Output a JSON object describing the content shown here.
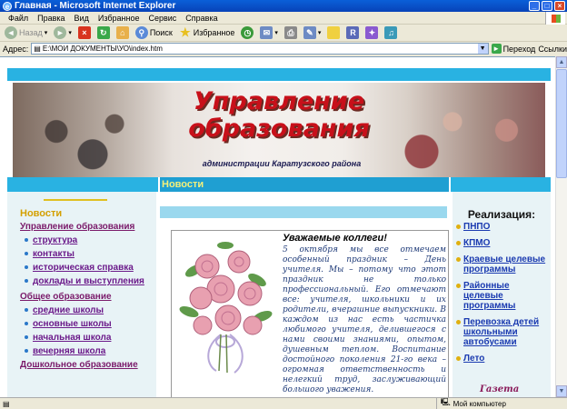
{
  "window": {
    "title": "Главная - Microsoft Internet Explorer"
  },
  "menu": [
    "Файл",
    "Правка",
    "Вид",
    "Избранное",
    "Сервис",
    "Справка"
  ],
  "toolbar": {
    "back": "Назад",
    "search": "Поиск",
    "favorites": "Избранное"
  },
  "address": {
    "label": "Адрес:",
    "value": "E:\\МОИ ДОКУМЕНТЫ\\УО\\index.htm",
    "go": "Переход",
    "links": "Ссылки"
  },
  "banner": {
    "title": "Управление образования",
    "subtitle": "администрации Каратузского района"
  },
  "news_header": "Новости",
  "left": {
    "news_label": "Новости",
    "items": [
      {
        "label": "Управление образования",
        "level": 0
      },
      {
        "label": "структура",
        "level": 1
      },
      {
        "label": "контакты",
        "level": 1
      },
      {
        "label": "историческая справка",
        "level": 1
      },
      {
        "label": "доклады и выступления",
        "level": 1
      },
      {
        "label": "Общее образование",
        "level": 0
      },
      {
        "label": "средние школы",
        "level": 1
      },
      {
        "label": "основные школы",
        "level": 1
      },
      {
        "label": "начальная школа",
        "level": 1
      },
      {
        "label": "вечерняя школа",
        "level": 1
      },
      {
        "label": "Дошкольное образование",
        "level": 0
      }
    ]
  },
  "article": {
    "heading": "Уважаемые коллеги!",
    "body": "5 октября мы все отмечаем особенный праздник – День учителя. Мы – потому что этот праздник не только профессиональный. Его отмечают все: учителя, школьники и их родители, вчерашние выпускники. В каждом из нас есть частичка любимого учителя, делившегося с нами своими знаниями, опытом, душевным теплом. Воспитание достойного поколения 21-го века – огромная ответственность и нелегкий труд, заслуживающий большого уважения."
  },
  "right": {
    "title": "Реализация:",
    "items": [
      "ПНПО",
      "КПМО",
      "Краевые целевые программы",
      "Районные целевые программы",
      "Перевозка детей школьными автобусами",
      "Лето"
    ],
    "gazette": "Газета"
  },
  "status": {
    "zone": "Мой компьютер"
  }
}
